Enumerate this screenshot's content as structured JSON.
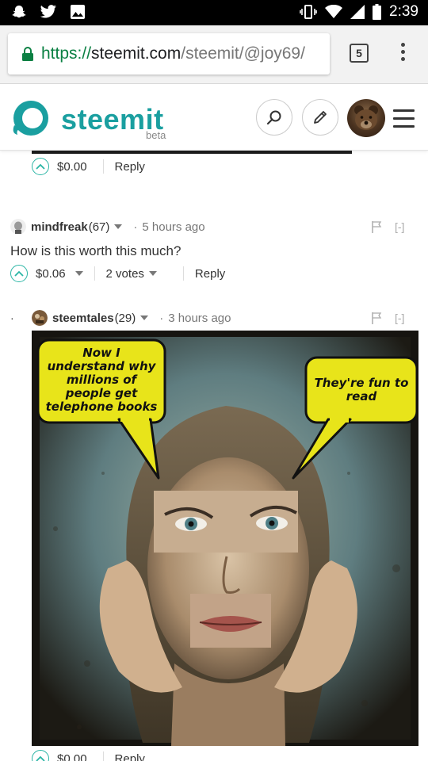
{
  "statusbar": {
    "time": "2:39"
  },
  "browser": {
    "url_scheme": "https://",
    "url_host": "steemit.com",
    "url_path": "/steemit/@joy69/",
    "tab_count": "5"
  },
  "header": {
    "brand": "steemit",
    "beta": "beta"
  },
  "previous_post": {
    "payout": "$0.00",
    "reply": "Reply"
  },
  "comment1": {
    "author": "mindfreak",
    "reputation": "(67)",
    "time": "5 hours ago",
    "collapse": "[-]",
    "body": "How is this worth this much?",
    "payout": "$0.06",
    "votes": "2 votes",
    "reply": "Reply"
  },
  "comment2": {
    "author": "steemtales",
    "reputation": "(29)",
    "time": "3 hours ago",
    "collapse": "[-]",
    "bubble_left": "Now I understand why millions of people get telephone books",
    "bubble_right": "They're fun to read",
    "payout": "$0.00",
    "reply": "Reply"
  },
  "colors": {
    "brand": "#1a9fa0",
    "upvote": "#2ab5a5",
    "secure": "#0b8043",
    "bubble": "#e8e41a"
  }
}
